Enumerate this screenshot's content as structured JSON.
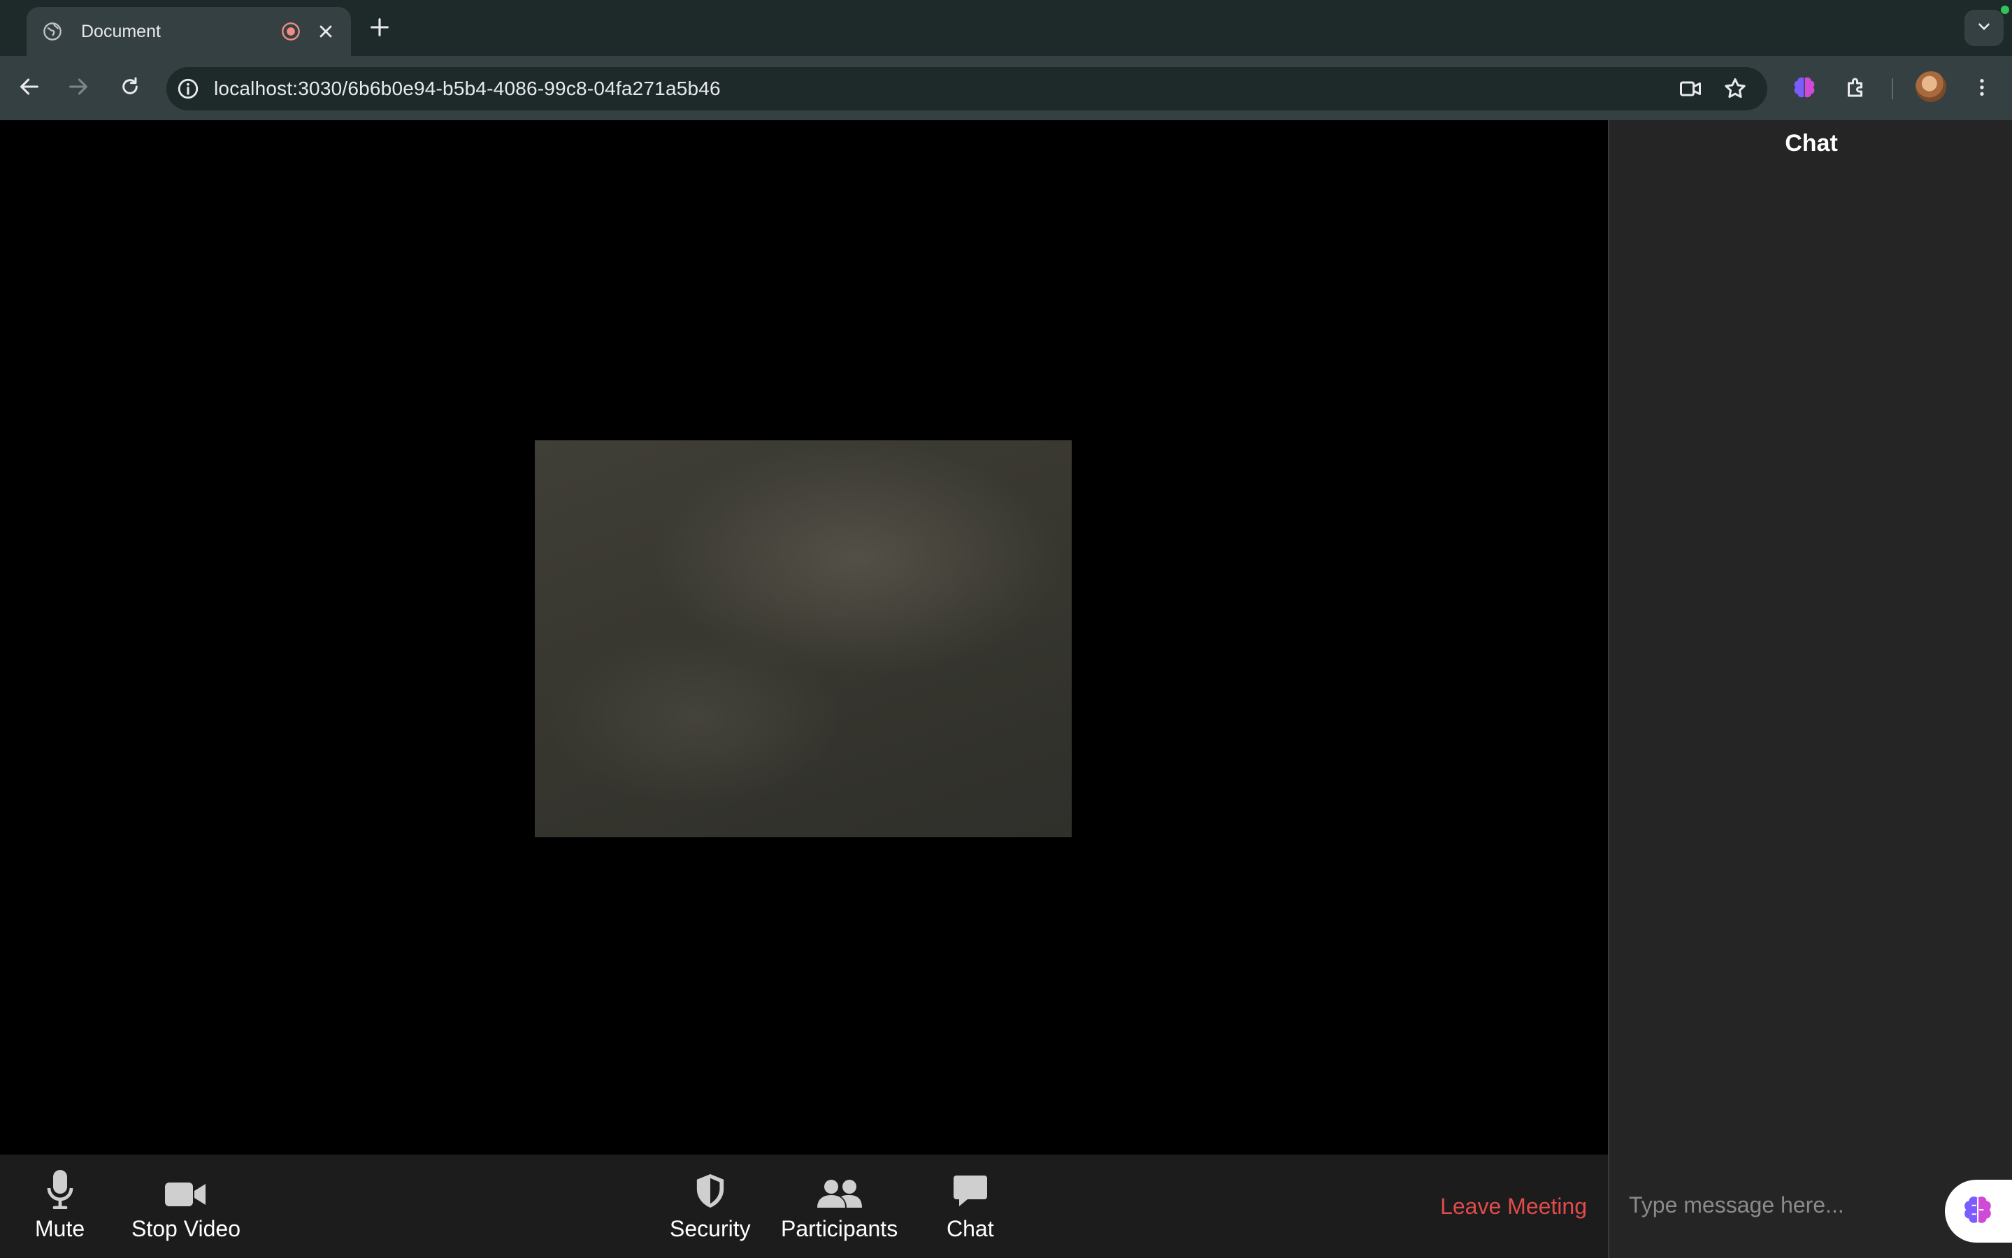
{
  "browser": {
    "tab": {
      "title": "Document"
    },
    "url": "localhost:3030/6b6b0e94-b5b4-4086-99c8-04fa271a5b46"
  },
  "controls": {
    "mute_label": "Mute",
    "stop_video_label": "Stop Video",
    "security_label": "Security",
    "participants_label": "Participants",
    "chat_label": "Chat",
    "leave_label": "Leave Meeting"
  },
  "chat": {
    "title": "Chat",
    "input_placeholder": "Type message here..."
  },
  "colors": {
    "leave": "#e24b4b",
    "chrome_dark": "#1e2a2a",
    "chrome_light": "#354042",
    "panel": "#252525",
    "controls_bar": "#1c1c1c"
  },
  "icons": [
    "globe-icon",
    "record-icon",
    "close-icon",
    "plus-icon",
    "chevron-down-icon",
    "back-icon",
    "forward-icon",
    "reload-icon",
    "info-icon",
    "camera-icon",
    "star-icon",
    "brain-icon",
    "puzzle-icon",
    "kebab-icon",
    "microphone-icon",
    "video-camera-icon",
    "shield-icon",
    "people-icon",
    "speech-bubble-icon"
  ]
}
